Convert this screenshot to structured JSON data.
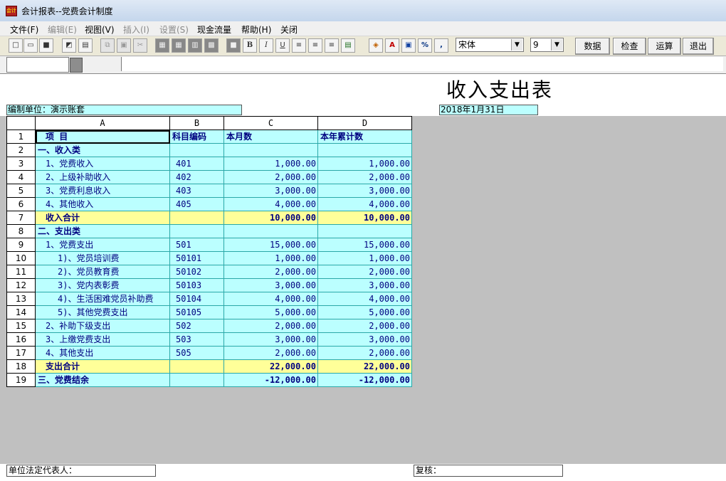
{
  "window": {
    "title": "会计报表--党费会计制度"
  },
  "menu": [
    {
      "label": "文件(F)",
      "enabled": true
    },
    {
      "label": "编辑(E)",
      "enabled": false
    },
    {
      "label": "视图(V)",
      "enabled": true
    },
    {
      "label": "插入(I)",
      "enabled": false
    },
    {
      "label": "设置(S)",
      "enabled": false
    },
    {
      "label": "现金流量",
      "enabled": true
    },
    {
      "label": "帮助(H)",
      "enabled": true
    },
    {
      "label": "关闭",
      "enabled": true
    }
  ],
  "toolbar": {
    "font_name": "宋体",
    "font_size": "9",
    "data_label": "数据",
    "check_label": "检查",
    "calc_label": "运算",
    "exit_label": "退出",
    "icons": [
      "new-file-icon",
      "open-folder-icon",
      "save-icon",
      "print-preview-icon",
      "print-icon",
      "copy-icon",
      "paste-icon",
      "cut-icon",
      "insert-row-icon",
      "delete-row-icon",
      "insert-col-icon",
      "delete-col-icon",
      "lock-icon",
      "bold-icon",
      "italic-icon",
      "underline-icon",
      "align-left-icon",
      "align-center-icon",
      "align-right-icon",
      "table-icon",
      "fill-color-icon",
      "font-color-icon",
      "border-icon",
      "percent-icon",
      "comma-icon"
    ]
  },
  "report": {
    "title": "收入支出表",
    "unit": "编制单位：演示账套",
    "date": "2018年1月31日",
    "legal_rep": "单位法定代表人：",
    "reviewer": "复核："
  },
  "grid": {
    "columns": [
      "A",
      "B",
      "C",
      "D"
    ],
    "rows": [
      {
        "n": "1",
        "name": "项    目",
        "code": "科目编码",
        "month": "本月数",
        "year": "本年累计数",
        "style": "hdr",
        "indent": 1
      },
      {
        "n": "2",
        "name": "一、收入类",
        "code": "",
        "month": "",
        "year": "",
        "style": "bold",
        "indent": 0
      },
      {
        "n": "3",
        "name": "1、党费收入",
        "code": "401",
        "month": "1,000.00",
        "year": "1,000.00",
        "style": "",
        "indent": 1
      },
      {
        "n": "4",
        "name": "2、上级补助收入",
        "code": "402",
        "month": "2,000.00",
        "year": "2,000.00",
        "style": "",
        "indent": 1
      },
      {
        "n": "5",
        "name": "3、党费利息收入",
        "code": "403",
        "month": "3,000.00",
        "year": "3,000.00",
        "style": "",
        "indent": 1
      },
      {
        "n": "6",
        "name": "4、其他收入",
        "code": "405",
        "month": "4,000.00",
        "year": "4,000.00",
        "style": "",
        "indent": 1
      },
      {
        "n": "7",
        "name": "收入合计",
        "code": "",
        "month": "10,000.00",
        "year": "10,000.00",
        "style": "total",
        "indent": 1
      },
      {
        "n": "8",
        "name": "二、支出类",
        "code": "",
        "month": "",
        "year": "",
        "style": "bold",
        "indent": 0
      },
      {
        "n": "9",
        "name": "1、党费支出",
        "code": "501",
        "month": "15,000.00",
        "year": "15,000.00",
        "style": "",
        "indent": 1
      },
      {
        "n": "10",
        "name": "1)、党员培训费",
        "code": "50101",
        "month": "1,000.00",
        "year": "1,000.00",
        "style": "",
        "indent": 2
      },
      {
        "n": "11",
        "name": "2)、党员教育费",
        "code": "50102",
        "month": "2,000.00",
        "year": "2,000.00",
        "style": "",
        "indent": 2
      },
      {
        "n": "12",
        "name": "3)、党内表彰费",
        "code": "50103",
        "month": "3,000.00",
        "year": "3,000.00",
        "style": "",
        "indent": 2
      },
      {
        "n": "13",
        "name": "4)、生活困难党员补助费",
        "code": "50104",
        "month": "4,000.00",
        "year": "4,000.00",
        "style": "",
        "indent": 2
      },
      {
        "n": "14",
        "name": "5)、其他党费支出",
        "code": "50105",
        "month": "5,000.00",
        "year": "5,000.00",
        "style": "",
        "indent": 2
      },
      {
        "n": "15",
        "name": "2、补助下级支出",
        "code": "502",
        "month": "2,000.00",
        "year": "2,000.00",
        "style": "",
        "indent": 1
      },
      {
        "n": "16",
        "name": "3、上缴党费支出",
        "code": "503",
        "month": "3,000.00",
        "year": "3,000.00",
        "style": "",
        "indent": 1
      },
      {
        "n": "17",
        "name": "4、其他支出",
        "code": "505",
        "month": "2,000.00",
        "year": "2,000.00",
        "style": "",
        "indent": 1
      },
      {
        "n": "18",
        "name": "支出合计",
        "code": "",
        "month": "22,000.00",
        "year": "22,000.00",
        "style": "total",
        "indent": 1
      },
      {
        "n": "19",
        "name": "三、党费结余",
        "code": "",
        "month": "-12,000.00",
        "year": "-12,000.00",
        "style": "bold",
        "indent": 0
      }
    ]
  },
  "colors": {
    "cell_bg": "#bbffff",
    "total_bg": "#ffff99",
    "text": "#000080",
    "grid_line": "#2aa8a8",
    "sheet_bg": "#c0c0c0"
  }
}
